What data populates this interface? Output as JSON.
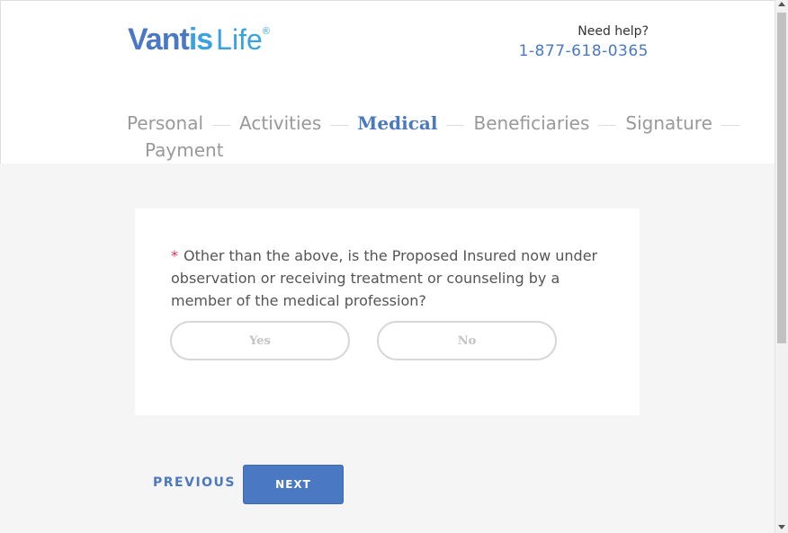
{
  "brand": {
    "name_part1": "Vant",
    "name_part2": "is",
    "name_part3": "Life",
    "trademark": "®"
  },
  "help": {
    "label": "Need help?",
    "phone": "1-877-618-0365"
  },
  "steps": [
    {
      "label": "Personal",
      "active": false
    },
    {
      "label": "Activities",
      "active": false
    },
    {
      "label": "Medical",
      "active": true
    },
    {
      "label": "Beneficiaries",
      "active": false
    },
    {
      "label": "Signature",
      "active": false
    },
    {
      "label": "Payment",
      "active": false
    }
  ],
  "question": {
    "required_mark": "*",
    "text": "Other than the above, is the Proposed Insured now under observation or receiving treatment or counseling by a member of the medical profession?",
    "options": {
      "yes": "Yes",
      "no": "No"
    }
  },
  "nav": {
    "previous": "PREVIOUS",
    "next": "NEXT"
  },
  "colors": {
    "brand_blue": "#4a78c2",
    "brand_light_blue": "#3aa3df",
    "required_red": "#e0314b"
  }
}
